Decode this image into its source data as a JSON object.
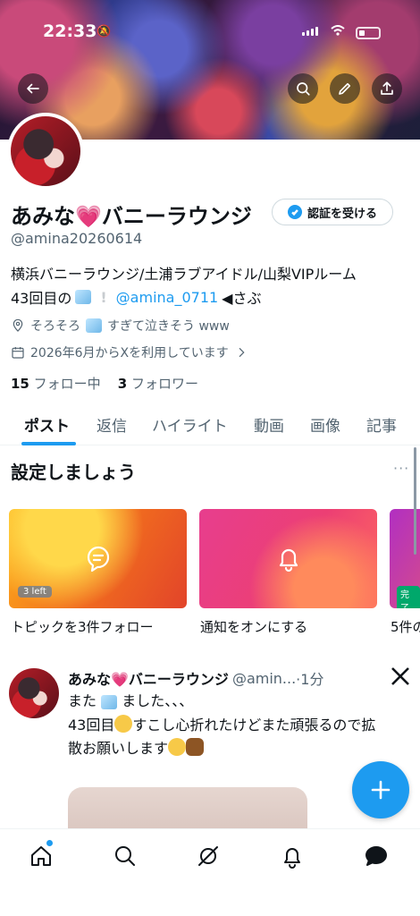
{
  "status_bar": {
    "time": "22:33"
  },
  "profile": {
    "name": "あみな💗バニーラウンジ",
    "handle": "@amina20260614",
    "verify_label": "認証を受ける",
    "bio_line1": "横浜バニーラウンジ/土浦ラブアイドル/山梨VIPルーム",
    "bio_line2_prefix": "43回目の",
    "bio_mention": "@amina_0711",
    "bio_line2_suffix": "◀さぶ",
    "location_prefix": "そろそろ",
    "location_suffix": "すぎて泣きそう www",
    "joined": "2026年6月からXを利用しています",
    "following_count": "15",
    "following_label": "フォロー中",
    "followers_count": "3",
    "followers_label": "フォロワー"
  },
  "tabs": [
    "ポスト",
    "返信",
    "ハイライト",
    "動画",
    "画像",
    "記事"
  ],
  "setup": {
    "title": "設定しましょう",
    "cards": [
      {
        "label": "トピックを3件フォロー",
        "badge": "3 left",
        "icon": "topic-icon"
      },
      {
        "label": "通知をオンにする",
        "icon": "bell-icon"
      },
      {
        "label": "5件の",
        "badge": "完了"
      }
    ]
  },
  "tweet": {
    "name": "あみな💗バニーラウンジ",
    "handle": "@amin...",
    "time": "·1分",
    "line1_prefix": "また",
    "line1_suffix": "ました、、、",
    "line2_prefix": "43回目",
    "line2_suffix": "すこし心折れたけどまた頑張るので拡",
    "line3": "散お願いします"
  },
  "colors": {
    "accent": "#1d9bf0",
    "text": "#0f1419",
    "muted": "#536471"
  }
}
